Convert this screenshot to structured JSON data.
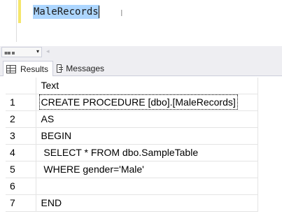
{
  "editor": {
    "code_line": "MaleRecords",
    "ibeam_glyph": "I"
  },
  "statusbar": {
    "zoom_glyph": "▪▪ ▪",
    "zoom_dropdown": "▾",
    "scroll_left": "◂"
  },
  "tabs": [
    {
      "label": "Results",
      "icon": "grid-icon",
      "active": true
    },
    {
      "label": "Messages",
      "icon": "messages-icon",
      "active": false
    }
  ],
  "grid": {
    "column_header": "Text",
    "rows": [
      {
        "num": "1",
        "text": "CREATE PROCEDURE [dbo].[MaleRecords]"
      },
      {
        "num": "2",
        "text": "AS"
      },
      {
        "num": "3",
        "text": "BEGIN"
      },
      {
        "num": "4",
        "text": " SELECT * FROM dbo.SampleTable"
      },
      {
        "num": "5",
        "text": " WHERE gender='Male'"
      },
      {
        "num": "6",
        "text": ""
      },
      {
        "num": "7",
        "text": "END"
      }
    ]
  },
  "colors": {
    "selection": "#add6ff",
    "change_mark": "#f5e66b",
    "chrome": "#eeeef2"
  }
}
